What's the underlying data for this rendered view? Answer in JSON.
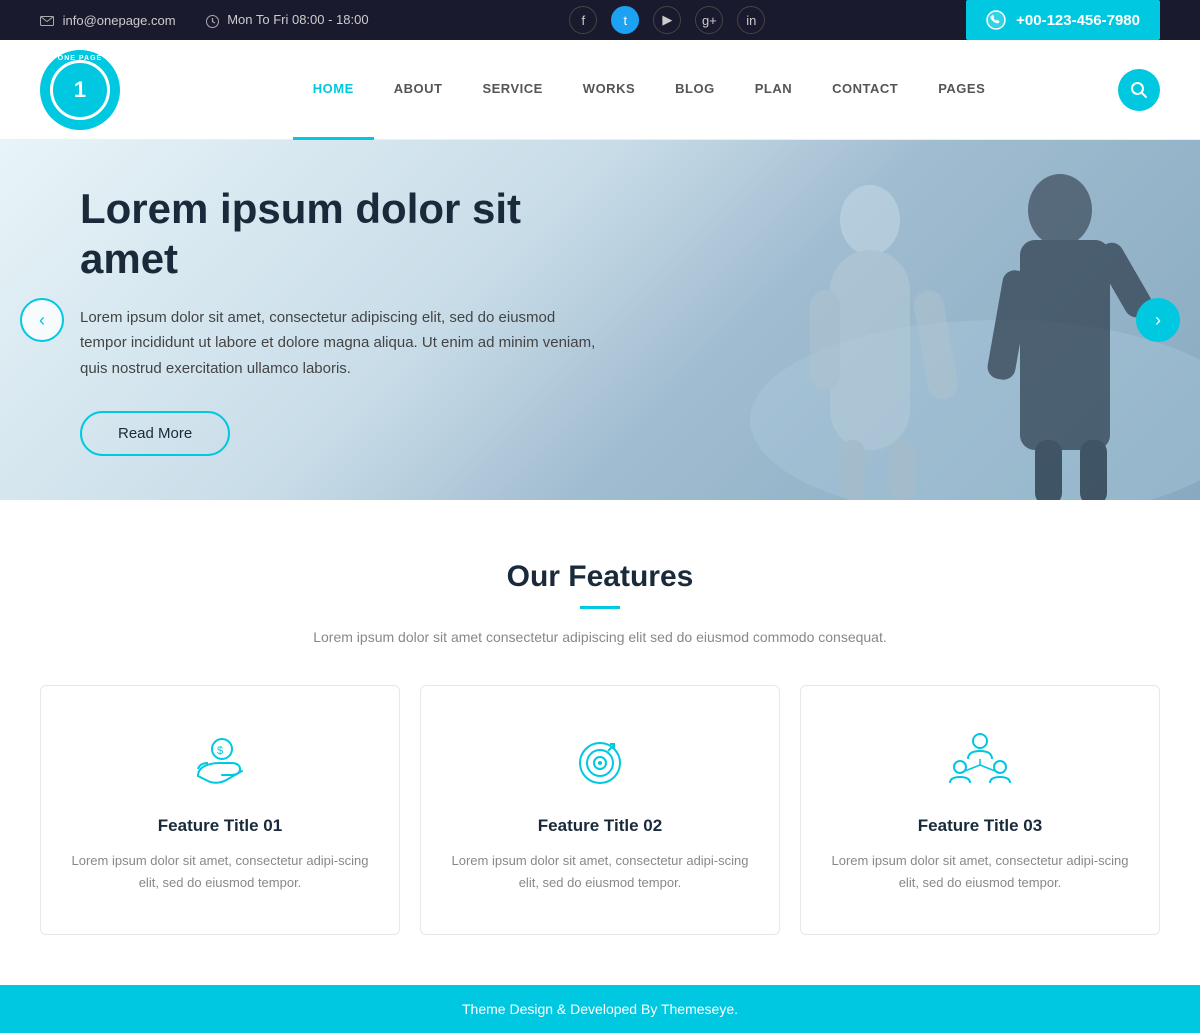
{
  "topbar": {
    "email": "info@onepage.com",
    "hours": "Mon To Fri 08:00 - 18:00",
    "phone": "+00-123-456-7980",
    "social": [
      "facebook",
      "twitter",
      "youtube",
      "google-plus",
      "linkedin"
    ]
  },
  "nav": {
    "brand": "ONE PAGE",
    "links": [
      {
        "label": "HOME",
        "active": true
      },
      {
        "label": "ABOUT",
        "active": false
      },
      {
        "label": "SERVICE",
        "active": false
      },
      {
        "label": "WORKS",
        "active": false
      },
      {
        "label": "BLOG",
        "active": false
      },
      {
        "label": "PLAN",
        "active": false
      },
      {
        "label": "CONTACT",
        "active": false
      },
      {
        "label": "PAGES",
        "active": false
      }
    ]
  },
  "hero": {
    "title": "Lorem ipsum dolor sit amet",
    "text": "Lorem ipsum dolor sit amet, consectetur adipiscing elit, sed do eiusmod tempor incididunt ut labore et dolore magna aliqua. Ut enim ad minim veniam, quis nostrud exercitation ullamco laboris.",
    "button": "Read More"
  },
  "features": {
    "title": "Our Features",
    "subtitle": "Lorem ipsum dolor sit amet consectetur adipiscing elit sed do eiusmod commodo consequat.",
    "cards": [
      {
        "title": "Feature Title 01",
        "text": "Lorem ipsum dolor sit amet, consectetur adipi-scing elit, sed do eiusmod tempor."
      },
      {
        "title": "Feature Title 02",
        "text": "Lorem ipsum dolor sit amet, consectetur adipi-scing elit, sed do eiusmod tempor."
      },
      {
        "title": "Feature Title 03",
        "text": "Lorem ipsum dolor sit amet, consectetur adipi-scing elit, sed do eiusmod tempor."
      }
    ]
  },
  "footer": {
    "text": "Theme Design & Developed By Themeseye."
  }
}
